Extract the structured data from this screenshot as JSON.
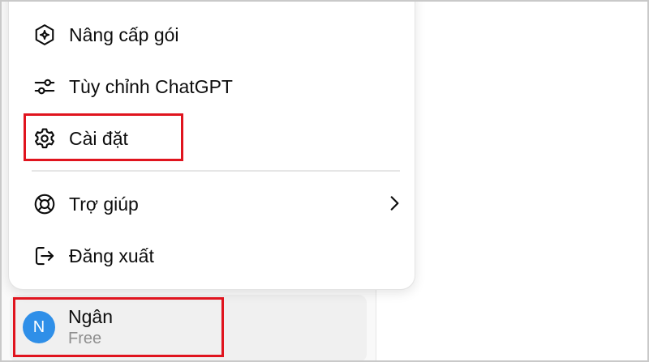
{
  "menu": {
    "items": [
      {
        "label": "Nâng cấp gói",
        "icon": "sparkle-hexagon-icon"
      },
      {
        "label": "Tùy chỉnh ChatGPT",
        "icon": "sliders-icon"
      },
      {
        "label": "Cài đặt",
        "icon": "gear-icon"
      },
      {
        "label": "Trợ giúp",
        "icon": "lifebuoy-icon",
        "has_submenu": true
      },
      {
        "label": "Đăng xuất",
        "icon": "logout-icon"
      }
    ]
  },
  "user": {
    "initial": "N",
    "name": "Ngân",
    "plan": "Free"
  },
  "colors": {
    "highlight": "#e0141e",
    "avatar": "#2f8fe8"
  }
}
